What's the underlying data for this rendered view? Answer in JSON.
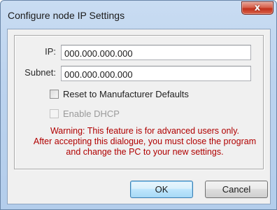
{
  "window": {
    "title": "Configure node IP Settings",
    "close_glyph": "x"
  },
  "form": {
    "ip_label": "IP:",
    "ip_value": "000.000.000.000",
    "subnet_label": "Subnet:",
    "subnet_value": "000.000.000.000",
    "reset_label": "Reset to Manufacturer Defaults",
    "reset_checked": false,
    "dhcp_label": "Enable DHCP",
    "dhcp_checked": false,
    "dhcp_enabled": false
  },
  "warning": {
    "line1": "Warning: This feature is for advanced users only.",
    "line2": "After accepting this dialogue, you must close the program",
    "line3": "and change the PC to your new settings.",
    "color": "#b00000"
  },
  "buttons": {
    "ok_label": "OK",
    "cancel_label": "Cancel"
  },
  "icons": {
    "close": "close-icon"
  }
}
